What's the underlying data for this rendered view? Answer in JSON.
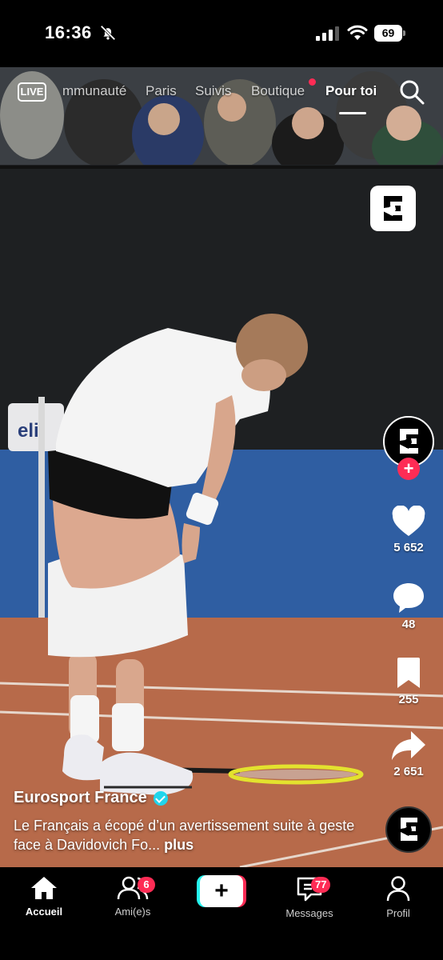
{
  "status_bar": {
    "time": "16:36",
    "battery": "69"
  },
  "top_tabs": {
    "live_label": "LIVE",
    "tabs": [
      {
        "label": "mmunauté",
        "active": false
      },
      {
        "label": "Paris",
        "active": false
      },
      {
        "label": "Suivis",
        "active": false
      },
      {
        "label": "Boutique",
        "active": false
      },
      {
        "label": "Pour toi",
        "active": true
      }
    ]
  },
  "actions": {
    "likes": "5 652",
    "comments": "48",
    "bookmarks": "255",
    "shares": "2 651"
  },
  "caption": {
    "author": "Eurosport France",
    "text": "Le Français a écopé d’un avertissement suite à geste face à Davidovich Fo...",
    "more_label": "plus"
  },
  "bottom_nav": {
    "items": [
      {
        "label": "Accueil",
        "badge": ""
      },
      {
        "label": "Ami(e)s",
        "badge": "6"
      },
      {
        "label": "Messages",
        "badge": "77"
      },
      {
        "label": "Profil",
        "badge": ""
      }
    ],
    "create_label": "+"
  },
  "colors": {
    "accent": "#fe2c55",
    "secondary": "#25f4ee",
    "verified": "#20d5ec"
  },
  "icons": [
    "bell-slash-icon",
    "signal-icon",
    "wifi-icon",
    "battery-icon",
    "live-tv-icon",
    "search-icon",
    "eurosport-logo",
    "heart-icon",
    "comment-icon",
    "bookmark-icon",
    "share-icon",
    "home-icon",
    "friends-icon",
    "inbox-icon",
    "profile-icon"
  ]
}
